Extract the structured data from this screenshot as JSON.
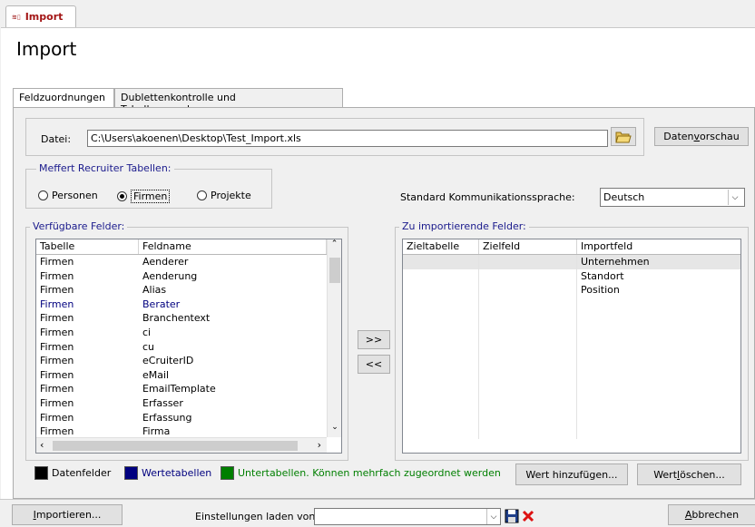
{
  "doc_tab": {
    "icon": "access-form-icon",
    "label": "Import"
  },
  "page_title": "Import",
  "tabs": [
    {
      "label": "Feldzuordnungen",
      "active": true
    },
    {
      "label": "Dublettenkontrolle und Tabellenzuordnungen",
      "active": false
    }
  ],
  "file": {
    "label": "Datei:",
    "value": "C:\\Users\\akoenen\\Desktop\\Test_Import.xls",
    "preview_button": {
      "pre": "Daten",
      "accel": "v",
      "post": "orschau"
    }
  },
  "recruiter": {
    "title": "Meffert Recruiter Tabellen:",
    "options": [
      {
        "label": "Personen",
        "selected": false
      },
      {
        "label": "Firmen",
        "selected": true
      },
      {
        "label": "Projekte",
        "selected": false
      }
    ]
  },
  "language": {
    "label_pre": "Standard Kommu",
    "label_bold": "nikationssprache:",
    "value": "Deutsch"
  },
  "available": {
    "title": "Verfügbare Felder:",
    "columns": [
      "Tabelle",
      "Feldname"
    ],
    "rows": [
      [
        "Firmen",
        "Aenderer"
      ],
      [
        "Firmen",
        "Aenderung"
      ],
      [
        "Firmen",
        "Alias"
      ],
      [
        "Firmen",
        "Berater"
      ],
      [
        "Firmen",
        "Branchentext"
      ],
      [
        "Firmen",
        "ci"
      ],
      [
        "Firmen",
        "cu"
      ],
      [
        "Firmen",
        "eCruiterID"
      ],
      [
        "Firmen",
        "eMail"
      ],
      [
        "Firmen",
        "EmailTemplate"
      ],
      [
        "Firmen",
        "Erfasser"
      ],
      [
        "Firmen",
        "Erfassung"
      ],
      [
        "Firmen",
        "Firma"
      ]
    ]
  },
  "move_buttons": {
    "add": ">>",
    "remove": "<<"
  },
  "import": {
    "title": "Zu importierende Felder:",
    "columns": [
      "Zieltabelle",
      "Zielfeld",
      "Importfeld"
    ],
    "rows": [
      [
        "",
        "",
        "Unternehmen"
      ],
      [
        "",
        "",
        "Standort"
      ],
      [
        "",
        "",
        "Position"
      ]
    ]
  },
  "legend": {
    "items": [
      {
        "label": "Datenfelder",
        "color": "#000000",
        "text_color": "#000000"
      },
      {
        "label": "Wertetabellen",
        "color": "#00007f",
        "text_color": "#00007f"
      },
      {
        "label": "Untertabellen. Können mehrfach zugeordnet werden",
        "color": "#007f00",
        "text_color": "#007f00"
      }
    ],
    "add_value_button": {
      "pre": "Wert hinzufügen..."
    },
    "delete_value_button": {
      "pre": "Wert ",
      "accel": "l",
      "post": "öschen..."
    }
  },
  "footer": {
    "import_button": {
      "accel": "I",
      "post": "mportieren..."
    },
    "settings_label": "Einstellungen laden von:",
    "settings_value": "",
    "cancel_button": {
      "accel": "A",
      "post": "bbrechen"
    }
  },
  "colors": {
    "link_blue": "#1a1a8c",
    "title_red": "#a31515"
  }
}
